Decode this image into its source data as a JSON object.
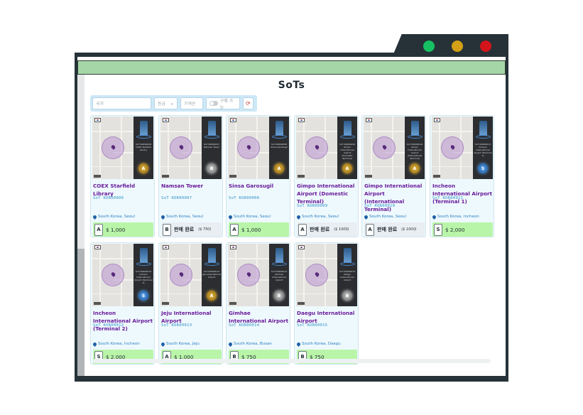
{
  "page": {
    "title": "SoTs"
  },
  "filters": {
    "search_placeholder": "국가",
    "grade_label": "등급",
    "price_label": "가격순",
    "available_label": "구매 가능",
    "reset_icon": "refresh-icon"
  },
  "colors": {
    "frame": "#263238",
    "header_bar": "#a5d6a7",
    "name": "#6a1b9a",
    "code": "#2e8fc4",
    "available": "#b9f5a8",
    "sold": "#e9eef3"
  },
  "cards": [
    {
      "name": "COEX Starfield Library",
      "code": "SoT KOR00006",
      "location": "South Korea, Seoul",
      "grade": "A",
      "status": "available",
      "price": "$ 1,000",
      "thumb_text": "SoT KOR00006 COEX Starfield Library"
    },
    {
      "name": "Namsan Tower",
      "code": "SoT KOR00007",
      "location": "South Korea, Seoul",
      "grade": "B",
      "status": "sold",
      "sold_label": "판매 완료",
      "price": "($ 750)",
      "thumb_text": "SoT KOR00007 Namsan Tower"
    },
    {
      "name": "Sinsa Garosugil",
      "code": "SoT KOR00008",
      "location": "South Korea, Seoul",
      "grade": "A",
      "status": "available",
      "price": "$ 1,000",
      "thumb_text": "SoT KOR00008 Sinsa Garosugil"
    },
    {
      "name": "Gimpo International Airport (Domestic Terminal)",
      "code": "SoT KOR00009",
      "location": "South Korea, Seoul",
      "grade": "A",
      "status": "sold",
      "sold_label": "판매 완료",
      "price": "($ 1000)",
      "thumb_text": "SoT KOR00009 Gimpo International Airport (Domestic Terminal)"
    },
    {
      "name": "Gimpo International Airport (International Terminal)",
      "code": "SoT KOR00010",
      "location": "South Korea, Seoul",
      "grade": "A",
      "status": "sold",
      "sold_label": "판매 완료",
      "price": "($ 1000)",
      "thumb_text": "SoT KOR00010 Gimpo International Airport (International Terminal)"
    },
    {
      "name": "Incheon International Airport (Terminal 1)",
      "code": "SoT KOR00011",
      "location": "South Korea, Incheon",
      "grade": "S",
      "status": "available",
      "price": "$ 2,000",
      "thumb_text": "SoT KOR00011 Incheon International Airport (Terminal 1)"
    },
    {
      "name": "Incheon International Airport (Terminal 2)",
      "code": "SoT KOR00012",
      "location": "South Korea, Incheon",
      "grade": "S",
      "status": "available",
      "price": "$ 2,000",
      "thumb_text": "SoT KOR00012 Incheon International Airport (Terminal 2)"
    },
    {
      "name": "Jeju International Airport",
      "code": "SoT KOR00013",
      "location": "South Korea, Jeju",
      "grade": "A",
      "status": "available",
      "price": "$ 1,000",
      "thumb_text": "SoT KOR00013 Jeju International Airport"
    },
    {
      "name": "Gimhae International Airport",
      "code": "SoT KOR00014",
      "location": "South Korea, Busan",
      "grade": "B",
      "status": "available",
      "price": "$ 750",
      "thumb_text": "SoT KOR00014 Gimhae International Airport"
    },
    {
      "name": "Daegu International Airport",
      "code": "SoT KOR00015",
      "location": "South Korea, Daegu",
      "grade": "B",
      "status": "available",
      "price": "$ 750",
      "thumb_text": "SoT KOR00015 Daegu International Airport"
    }
  ]
}
